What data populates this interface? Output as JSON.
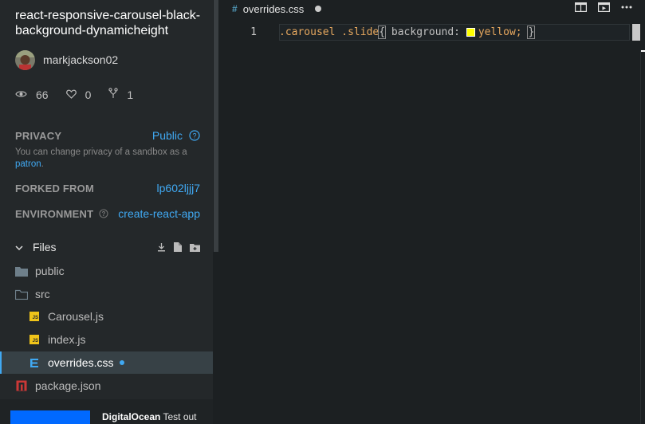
{
  "sandbox": {
    "title": "react-responsive-carousel-black-background-dynamicheight",
    "author": "markjackson02",
    "stats": {
      "views": "66",
      "likes": "0",
      "forks": "1"
    }
  },
  "privacy": {
    "label": "PRIVACY",
    "value": "Public",
    "note": "You can change privacy of a sandbox as a",
    "note_link": "patron",
    "note_end": "."
  },
  "forked_from": {
    "label": "FORKED FROM",
    "value": "lp602ljjj7"
  },
  "environment": {
    "label": "ENVIRONMENT",
    "value": "create-react-app"
  },
  "files": {
    "label": "Files",
    "tree": [
      {
        "name": "public",
        "type": "folder"
      },
      {
        "name": "src",
        "type": "folder"
      },
      {
        "name": "Carousel.js",
        "type": "js"
      },
      {
        "name": "index.js",
        "type": "js"
      },
      {
        "name": "overrides.css",
        "type": "css",
        "active": true,
        "modified": true
      },
      {
        "name": "package.json",
        "type": "npm"
      }
    ]
  },
  "sponsor": {
    "brand": "DigitalOcean",
    "text": " Test out"
  },
  "editor": {
    "tab": {
      "filename": "overrides.css"
    },
    "line_number": "1",
    "code": {
      "selector1": ".carousel",
      "selector2": ".slide",
      "open_brace": "{",
      "property": " background: ",
      "value": "yellow;",
      "close_brace": "}"
    }
  },
  "colors": {
    "accent": "#40a9f3",
    "js_badge": "#f0c419",
    "css_icon": "#40a9f3",
    "npm_icon": "#cb3837",
    "swatch": "#ffff00"
  }
}
